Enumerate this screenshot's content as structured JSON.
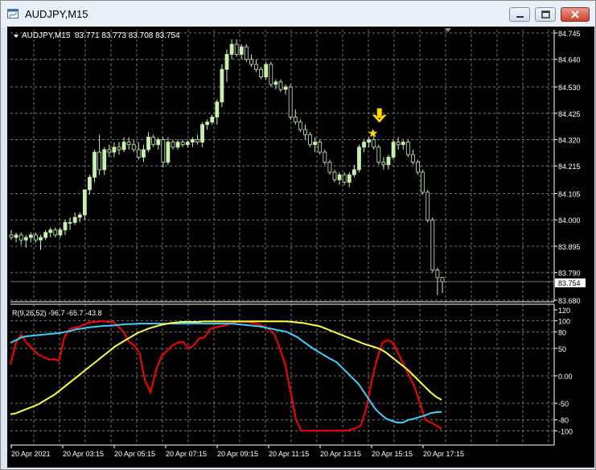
{
  "window": {
    "title": "AUDJPY,M15"
  },
  "chart": {
    "header": {
      "symbol_tf": "AUDJPY,M15",
      "ohlc": "83.771 83.773 83.708 83.754"
    },
    "current_price_label": "83.754",
    "price_ticks": [
      "84.745",
      "84.640",
      "84.530",
      "84.425",
      "84.320",
      "84.215",
      "84.105",
      "84.000",
      "83.895",
      "83.790",
      "83.680"
    ],
    "time_labels": [
      "20 Apr 2021",
      "20 Apr 03:15",
      "20 Apr 05:15",
      "20 Apr 07:15",
      "20 Apr 09:15",
      "20 Apr 11:15",
      "20 Apr 13:15",
      "20 Apr 15:15",
      "20 Apr 17:15"
    ],
    "colors": {
      "background": "#000000",
      "candle": "#c8f0b0",
      "grid": "#777777",
      "axis_text": "#ffffff",
      "arrow": "#ffd700",
      "star": "#ffd700"
    },
    "markers": [
      {
        "type": "down-arrow",
        "color": "#ffd700"
      },
      {
        "type": "star",
        "color": "#ffd700"
      }
    ]
  },
  "indicator": {
    "label": "R(9,26,52) -96.7 -65.7 -43.8",
    "ticks": [
      "120",
      "100",
      "80",
      "50",
      "0.00",
      "-50",
      "-80",
      "-100"
    ]
  },
  "chart_data": {
    "type": "candlestick",
    "symbol": "AUDJPY",
    "timeframe": "M15",
    "ylim": [
      83.68,
      84.745
    ],
    "last_ohlc": [
      83.771,
      83.773,
      83.708,
      83.754
    ],
    "candles": [
      [
        83.94,
        83.96,
        83.92,
        83.93
      ],
      [
        83.93,
        83.95,
        83.91,
        83.94
      ],
      [
        83.94,
        83.95,
        83.9,
        83.92
      ],
      [
        83.92,
        83.94,
        83.89,
        83.93
      ],
      [
        83.93,
        83.95,
        83.91,
        83.94
      ],
      [
        83.94,
        83.95,
        83.91,
        83.92
      ],
      [
        83.92,
        83.94,
        83.88,
        83.93
      ],
      [
        83.93,
        83.96,
        83.92,
        83.95
      ],
      [
        83.95,
        83.97,
        83.93,
        83.96
      ],
      [
        83.96,
        83.97,
        83.93,
        83.94
      ],
      [
        83.94,
        83.97,
        83.93,
        83.96
      ],
      [
        83.96,
        84.0,
        83.94,
        83.99
      ],
      [
        83.99,
        84.01,
        83.96,
        83.99
      ],
      [
        83.99,
        84.03,
        83.98,
        84.01
      ],
      [
        84.01,
        84.03,
        83.99,
        84.02
      ],
      [
        84.02,
        84.12,
        84.0,
        84.12
      ],
      [
        84.12,
        84.18,
        84.1,
        84.17
      ],
      [
        84.17,
        84.28,
        84.15,
        84.27
      ],
      [
        84.27,
        84.34,
        84.18,
        84.2
      ],
      [
        84.2,
        84.29,
        84.18,
        84.28
      ],
      [
        84.28,
        84.3,
        84.25,
        84.27
      ],
      [
        84.27,
        84.31,
        84.25,
        84.29
      ],
      [
        84.29,
        84.31,
        84.26,
        84.28
      ],
      [
        84.28,
        84.33,
        84.27,
        84.31
      ],
      [
        84.31,
        84.33,
        84.28,
        84.3
      ],
      [
        84.3,
        84.32,
        84.27,
        84.28
      ],
      [
        84.28,
        84.31,
        84.24,
        84.25
      ],
      [
        84.25,
        84.3,
        84.23,
        84.28
      ],
      [
        84.28,
        84.35,
        84.27,
        84.33
      ],
      [
        84.33,
        84.34,
        84.29,
        84.3
      ],
      [
        84.3,
        84.33,
        84.28,
        84.32
      ],
      [
        84.32,
        84.33,
        84.21,
        84.23
      ],
      [
        84.23,
        84.33,
        84.22,
        84.31
      ],
      [
        84.31,
        84.32,
        84.28,
        84.29
      ],
      [
        84.29,
        84.32,
        84.28,
        84.31
      ],
      [
        84.31,
        84.32,
        84.29,
        84.3
      ],
      [
        84.3,
        84.32,
        84.29,
        84.31
      ],
      [
        84.31,
        84.33,
        84.29,
        84.32
      ],
      [
        84.32,
        84.34,
        84.3,
        84.31
      ],
      [
        84.31,
        84.39,
        84.29,
        84.38
      ],
      [
        84.38,
        84.4,
        84.36,
        84.39
      ],
      [
        84.39,
        84.42,
        84.38,
        84.41
      ],
      [
        84.41,
        84.48,
        84.38,
        84.47
      ],
      [
        84.47,
        84.62,
        84.45,
        84.6
      ],
      [
        84.6,
        84.68,
        84.55,
        84.66
      ],
      [
        84.66,
        84.72,
        84.64,
        84.7
      ],
      [
        84.7,
        84.72,
        84.65,
        84.66
      ],
      [
        84.66,
        84.7,
        84.64,
        84.69
      ],
      [
        84.69,
        84.7,
        84.63,
        84.64
      ],
      [
        84.64,
        84.66,
        84.61,
        84.62
      ],
      [
        84.62,
        84.64,
        84.59,
        84.6
      ],
      [
        84.6,
        84.61,
        84.56,
        84.57
      ],
      [
        84.57,
        84.63,
        84.56,
        84.62
      ],
      [
        84.62,
        84.63,
        84.53,
        84.54
      ],
      [
        84.54,
        84.56,
        84.52,
        84.55
      ],
      [
        84.55,
        84.56,
        84.51,
        84.52
      ],
      [
        84.52,
        84.54,
        84.5,
        84.53
      ],
      [
        84.53,
        84.54,
        84.4,
        84.41
      ],
      [
        84.41,
        84.44,
        84.38,
        84.39
      ],
      [
        84.39,
        84.4,
        84.35,
        84.36
      ],
      [
        84.36,
        84.38,
        84.32,
        84.34
      ],
      [
        84.34,
        84.35,
        84.29,
        84.3
      ],
      [
        84.3,
        84.33,
        84.27,
        84.31
      ],
      [
        84.31,
        84.32,
        84.26,
        84.27
      ],
      [
        84.27,
        84.28,
        84.22,
        84.23
      ],
      [
        84.23,
        84.24,
        84.18,
        84.19
      ],
      [
        84.19,
        84.2,
        84.15,
        84.16
      ],
      [
        84.16,
        84.19,
        84.14,
        84.18
      ],
      [
        84.18,
        84.19,
        84.14,
        84.15
      ],
      [
        84.15,
        84.19,
        84.13,
        84.18
      ],
      [
        84.18,
        84.22,
        84.17,
        84.2
      ],
      [
        84.2,
        84.3,
        84.19,
        84.29
      ],
      [
        84.29,
        84.32,
        84.27,
        84.31
      ],
      [
        84.31,
        84.33,
        84.29,
        84.32
      ],
      [
        84.32,
        84.34,
        84.28,
        84.29
      ],
      [
        84.29,
        84.3,
        84.22,
        84.23
      ],
      [
        84.23,
        84.25,
        84.2,
        84.22
      ],
      [
        84.22,
        84.26,
        84.2,
        84.25
      ],
      [
        84.25,
        84.32,
        84.24,
        84.31
      ],
      [
        84.31,
        84.33,
        84.28,
        84.3
      ],
      [
        84.3,
        84.32,
        84.28,
        84.31
      ],
      [
        84.31,
        84.32,
        84.25,
        84.26
      ],
      [
        84.26,
        84.28,
        84.22,
        84.23
      ],
      [
        84.23,
        84.24,
        84.18,
        84.19
      ],
      [
        84.19,
        84.2,
        84.1,
        84.11
      ],
      [
        84.11,
        84.12,
        83.99,
        84.0
      ],
      [
        84.0,
        84.01,
        83.79,
        83.8
      ],
      [
        83.8,
        83.81,
        83.7,
        83.77
      ],
      [
        83.771,
        83.773,
        83.708,
        83.754
      ]
    ],
    "indicator_range": [
      -120,
      120
    ],
    "indicator_series": [
      {
        "color": "#ff0000",
        "values": [
          20,
          60,
          75,
          60,
          50,
          40,
          35,
          30,
          30,
          28,
          70,
          85,
          88,
          90,
          95,
          98,
          98,
          100,
          98,
          98,
          90,
          80,
          62,
          55,
          40,
          -10,
          -30,
          10,
          35,
          45,
          55,
          60,
          62,
          50,
          55,
          68,
          70,
          85,
          88,
          90,
          92,
          95,
          98,
          98,
          98,
          96,
          94,
          90,
          85,
          75,
          50,
          20,
          -30,
          -80,
          -100,
          -100,
          -100,
          -100,
          -100,
          -100,
          -100,
          -100,
          -100,
          -98,
          -96,
          -90,
          -60,
          -10,
          30,
          60,
          65,
          60,
          40,
          20,
          0,
          -20,
          -50,
          -80,
          -85,
          -90,
          -96.7
        ]
      },
      {
        "color": "#40d0ff",
        "values": [
          60,
          65,
          70,
          72,
          73,
          74,
          75,
          76,
          77,
          78,
          80,
          82,
          85,
          86,
          88,
          89,
          90,
          91,
          91,
          92,
          93,
          94,
          94,
          95,
          95,
          95,
          95,
          95,
          95,
          95,
          95,
          95,
          95,
          95,
          95,
          95,
          95,
          95,
          95,
          95,
          95,
          94,
          93,
          92,
          91,
          90,
          88,
          86,
          84,
          82,
          80,
          75,
          70,
          62,
          55,
          48,
          42,
          36,
          30,
          25,
          15,
          5,
          -5,
          -15,
          -30,
          -45,
          -60,
          -70,
          -78,
          -82,
          -85,
          -85,
          -80,
          -78,
          -75,
          -72,
          -68,
          -66,
          -65.7
        ]
      },
      {
        "color": "#ffff40",
        "values": [
          -70,
          -68,
          -64,
          -60,
          -56,
          -52,
          -46,
          -40,
          -34,
          -26,
          -18,
          -10,
          -2,
          6,
          14,
          22,
          30,
          38,
          46,
          54,
          60,
          66,
          72,
          78,
          82,
          86,
          89,
          92,
          94,
          96,
          97,
          98,
          98,
          98,
          98,
          99,
          99,
          99,
          99,
          99,
          99,
          99,
          99,
          99,
          99,
          99,
          99,
          99,
          99,
          99,
          99,
          98,
          97,
          96,
          94,
          92,
          90,
          86,
          82,
          78,
          74,
          70,
          66,
          62,
          58,
          55,
          52,
          48,
          42,
          34,
          26,
          18,
          10,
          0,
          -10,
          -20,
          -30,
          -38,
          -43.8
        ]
      }
    ]
  }
}
